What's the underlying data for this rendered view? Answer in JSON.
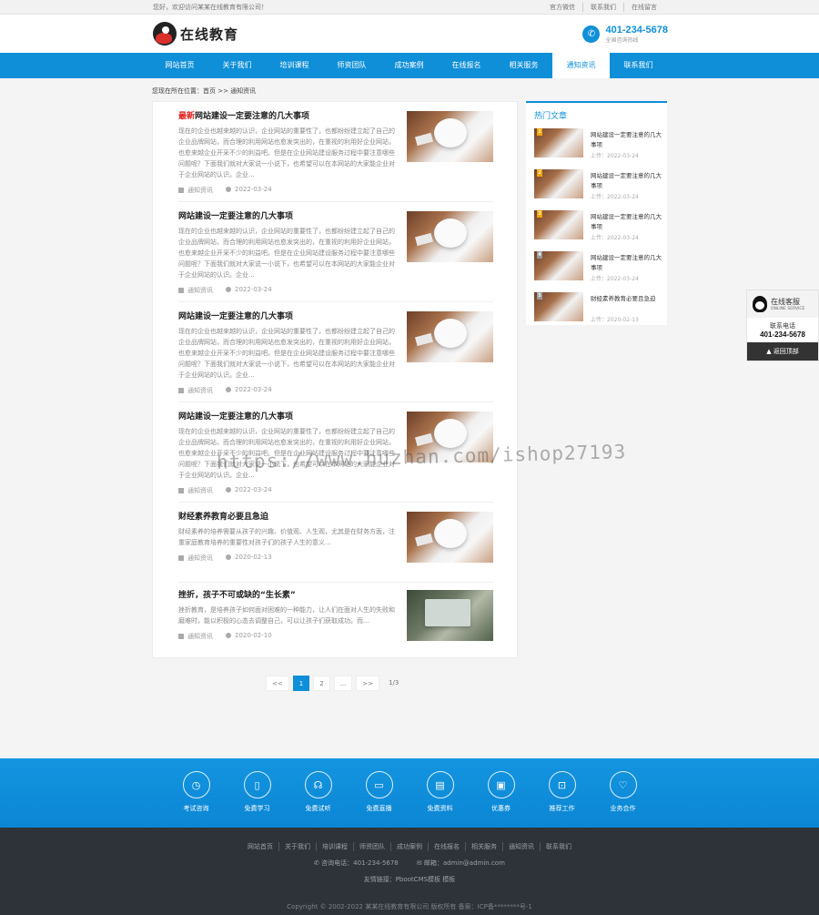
{
  "topbar": {
    "welcome": "您好，欢迎访问某某在线教育有限公司！",
    "links": [
      "官方微信",
      "联系我们",
      "在线留言"
    ]
  },
  "header": {
    "logo_text": "在线教育",
    "hotline": "401-234-5678",
    "hotline_sub": "全国咨询热线"
  },
  "nav": {
    "items": [
      "网站首页",
      "关于我们",
      "培训课程",
      "师资团队",
      "成功案例",
      "在线报名",
      "相关服务",
      "通知资讯",
      "联系我们"
    ],
    "active_index": 7
  },
  "breadcrumb": "您现在所在位置：首页 >> 通知资讯",
  "articles": [
    {
      "tag": "最新",
      "title": "网站建设一定要注意的几大事项",
      "desc": "现在的企业也越来越的认识，企业网站的重要性了，也都纷纷建立起了自己的企业品牌网站，而合理的利用网站也愈发突出的，在重视的利用好企业网站，也愈来越企业开采不少的利益吧。但是在企业网站建设服务过程中要注意哪些问题呢？下面我们就对大家说一小说下，也希望可以在本网站的大家能企业对于企业网站的认识。企业...",
      "category": "通知资讯",
      "date": "2022-03-24",
      "thumb": "photo"
    },
    {
      "tag": "",
      "title": "网站建设一定要注意的几大事项",
      "desc": "现在的企业也越来越的认识，企业网站的重要性了，也都纷纷建立起了自己的企业品牌网站，而合理的利用网站也愈发突出的，在重视的利用好企业网站，也愈来越企业开采不少的利益吧。但是在企业网站建设服务过程中要注意哪些问题呢？下面我们就对大家说一小说下，也希望可以在本网站的大家能企业对于企业网站的认识。企业...",
      "category": "通知资讯",
      "date": "2022-03-24",
      "thumb": "photo"
    },
    {
      "tag": "",
      "title": "网站建设一定要注意的几大事项",
      "desc": "现在的企业也越来越的认识，企业网站的重要性了，也都纷纷建立起了自己的企业品牌网站，而合理的利用网站也愈发突出的，在重视的利用好企业网站，也愈来越企业开采不少的利益吧。但是在企业网站建设服务过程中要注意哪些问题呢？下面我们就对大家说一小说下，也希望可以在本网站的大家能企业对于企业网站的认识。企业...",
      "category": "通知资讯",
      "date": "2022-03-24",
      "thumb": "photo"
    },
    {
      "tag": "",
      "title": "网站建设一定要注意的几大事项",
      "desc": "现在的企业也越来越的认识，企业网站的重要性了，也都纷纷建立起了自己的企业品牌网站，而合理的利用网站也愈发突出的，在重视的利用好企业网站，也愈来越企业开采不少的利益吧。但是在企业网站建设服务过程中要注意哪些问题呢？下面我们就对大家说一小说下，也希望可以在本网站的大家能企业对于企业网站的认识。企业...",
      "category": "通知资讯",
      "date": "2022-03-24",
      "thumb": "photo"
    },
    {
      "tag": "",
      "title": "财经素养教育必要且急迫",
      "desc": "财经素养的培养需要从孩子的兴趣、价值观、人生观，尤其是在财务方面，注重家庭教育培养的重要性对孩子们的孩子人生的意义...",
      "category": "通知资讯",
      "date": "2020-02-13",
      "thumb": "photo"
    },
    {
      "tag": "",
      "title": "挫折，孩子不可或缺的“生长素”",
      "desc": "挫折教育，是培养孩子如何面对困难的一种能力，让人们在面对人生的失败和磨难时，能以积极的心态去调整自己，可以让孩子们获取成功。而...",
      "category": "通知资讯",
      "date": "2020-02-10",
      "thumb": "laptop"
    }
  ],
  "pagination": {
    "first": "<<",
    "pages": [
      "1",
      "2",
      "..."
    ],
    "next": ">>",
    "info": "1/3",
    "current": "1"
  },
  "sidebar": {
    "title": "热门文章",
    "items": [
      {
        "rank": "1",
        "title": "网站建设一定要注意的几大事项",
        "date": "上传：2022-03-24"
      },
      {
        "rank": "2",
        "title": "网站建设一定要注意的几大事项",
        "date": "上传：2022-03-24"
      },
      {
        "rank": "3",
        "title": "网站建设一定要注意的几大事项",
        "date": "上传：2022-03-24"
      },
      {
        "rank": "4",
        "title": "网站建设一定要注意的几大事项",
        "date": "上传：2022-03-24"
      },
      {
        "rank": "5",
        "title": "财经素养教育必要且急迫",
        "date": "上传：2020-02-13"
      }
    ]
  },
  "float_service": {
    "title": "在线客服",
    "subtitle": "ONLINE SERVICE",
    "phone_label": "联系电话",
    "phone": "401-234-5678",
    "back_top": "返回顶部"
  },
  "watermark": "https://www.huzhan.com/ishop27193",
  "services": [
    {
      "label": "考试咨询",
      "icon": "clock-icon",
      "glyph": "◷"
    },
    {
      "label": "免费学习",
      "icon": "book-icon",
      "glyph": "▯"
    },
    {
      "label": "免费试听",
      "icon": "headphones-icon",
      "glyph": "☊"
    },
    {
      "label": "免费直播",
      "icon": "live-icon",
      "glyph": "▭"
    },
    {
      "label": "免费资料",
      "icon": "document-icon",
      "glyph": "▤"
    },
    {
      "label": "优惠券",
      "icon": "coupon-icon",
      "glyph": "▣"
    },
    {
      "label": "推荐工作",
      "icon": "briefcase-icon",
      "glyph": "⊡"
    },
    {
      "label": "业务合作",
      "icon": "handshake-icon",
      "glyph": "♡"
    }
  ],
  "footer": {
    "nav": [
      "网站首页",
      "关于我们",
      "培训课程",
      "师资团队",
      "成功案例",
      "在线报名",
      "相关服务",
      "通知资讯",
      "联系我们"
    ],
    "phone": "咨询电话：401-234-5678",
    "email": "邮箱：admin@admin.com",
    "friend_links": "友情链接：PbootCMS模板 模板",
    "copyright": "Copyright © 2002-2022 某某在线教育有限公司 版权所有 备案：ICP备********号-1"
  },
  "colors": {
    "accent": "#0f8fd8",
    "tag_red": "#e02020",
    "footer_bg": "#2d3338"
  }
}
